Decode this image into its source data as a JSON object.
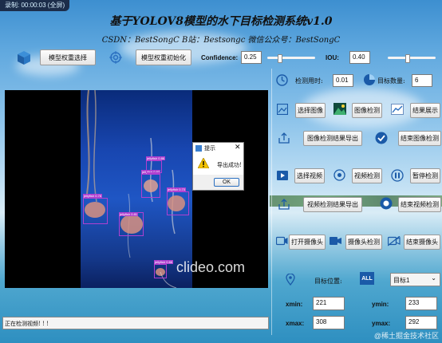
{
  "window": {
    "recording_badge": "录制: 00:00:03 (全屏)"
  },
  "header": {
    "title": "基于YOLOV8模型的水下目标检测系统v1.0",
    "subtitle": "CSDN：BestSongC   B站：Bestsongc   微信公众号：BestSongC"
  },
  "toolbar": {
    "model_select": "模型权重选择",
    "model_init": "模型权重初始化",
    "confidence_label": "Confidence:",
    "confidence_value": "0.25",
    "confidence_level": 0.25,
    "iou_label": "IOU:",
    "iou_value": "0.40",
    "iou_level": 0.4
  },
  "stats": {
    "time_label": "检测用时:",
    "time_value": "0.01",
    "count_label": "目标数量:",
    "count_value": "6"
  },
  "buttons": {
    "select_image": "选择图像",
    "detect_image": "图像检测",
    "show_result": "结果展示",
    "export_image": "图像检测结果导出",
    "end_image": "结束图像检测",
    "select_video": "选择视频",
    "detect_video": "视频检测",
    "pause_detect": "暂停检测",
    "export_video": "视频检测结果导出",
    "end_video": "结束视频检测",
    "open_camera": "打开摄像头",
    "detect_camera": "摄像头检测",
    "close_camera": "结束摄像头"
  },
  "target": {
    "position_label": "目标位置:",
    "selected": "目标1",
    "xmin_label": "xmin:",
    "xmin": "221",
    "ymin_label": "ymin:",
    "ymin": "233",
    "xmax_label": "xmax:",
    "xmax": "308",
    "ymax_label": "ymax:",
    "ymax": "292"
  },
  "video": {
    "watermark": "clideo.com",
    "detections": [
      {
        "label": "jellyfish 0.78"
      },
      {
        "label": "jellyfish 0.81"
      },
      {
        "label": "jellyfish 0.83"
      },
      {
        "label": "jellyfish 0.86"
      },
      {
        "label": "jellyfish 0.73"
      },
      {
        "label": "jellyfish 0.66"
      }
    ]
  },
  "dialog": {
    "title": "提示",
    "message": "导出成功!",
    "ok": "OK"
  },
  "status": {
    "text": "正在检测视频! ! !"
  },
  "corner_watermark": "@稀土掘金技术社区",
  "colors": {
    "detection_box": "#b040d0",
    "title_text": "#111111"
  }
}
